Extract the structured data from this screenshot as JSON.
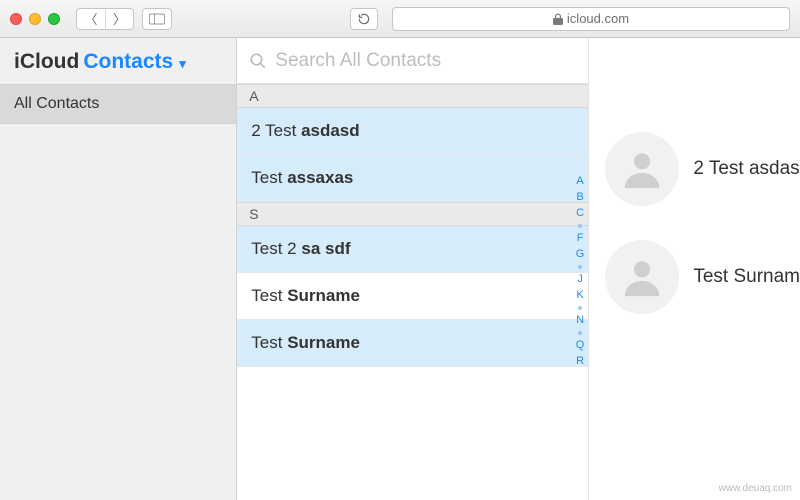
{
  "browser": {
    "url_host": "icloud.com"
  },
  "header": {
    "app_name": "iCloud",
    "section": "Contacts"
  },
  "sidebar": {
    "groups": [
      "All Contacts"
    ]
  },
  "search": {
    "placeholder": "Search All Contacts"
  },
  "sections": [
    {
      "letter": "A",
      "contacts": [
        {
          "prefix": "2 Test ",
          "bold": "asdasd",
          "selected": true
        },
        {
          "prefix": "Test ",
          "bold": "assaxas",
          "selected": true
        }
      ]
    },
    {
      "letter": "S",
      "contacts": [
        {
          "prefix": "Test 2 ",
          "bold": "sa sdf",
          "selected": true
        },
        {
          "prefix": "Test ",
          "bold": "Surname",
          "selected": false
        },
        {
          "prefix": "Test ",
          "bold": "Surname",
          "selected": true
        }
      ]
    }
  ],
  "alpha_index": [
    "A",
    "B",
    "C",
    "•",
    "F",
    "G",
    "•",
    "J",
    "K",
    "•",
    "N",
    "•",
    "Q",
    "R"
  ],
  "detail_cards": [
    {
      "name": "2 Test asdas"
    },
    {
      "name": "Test Surnam"
    }
  ],
  "watermark": "www.deuaq.com"
}
